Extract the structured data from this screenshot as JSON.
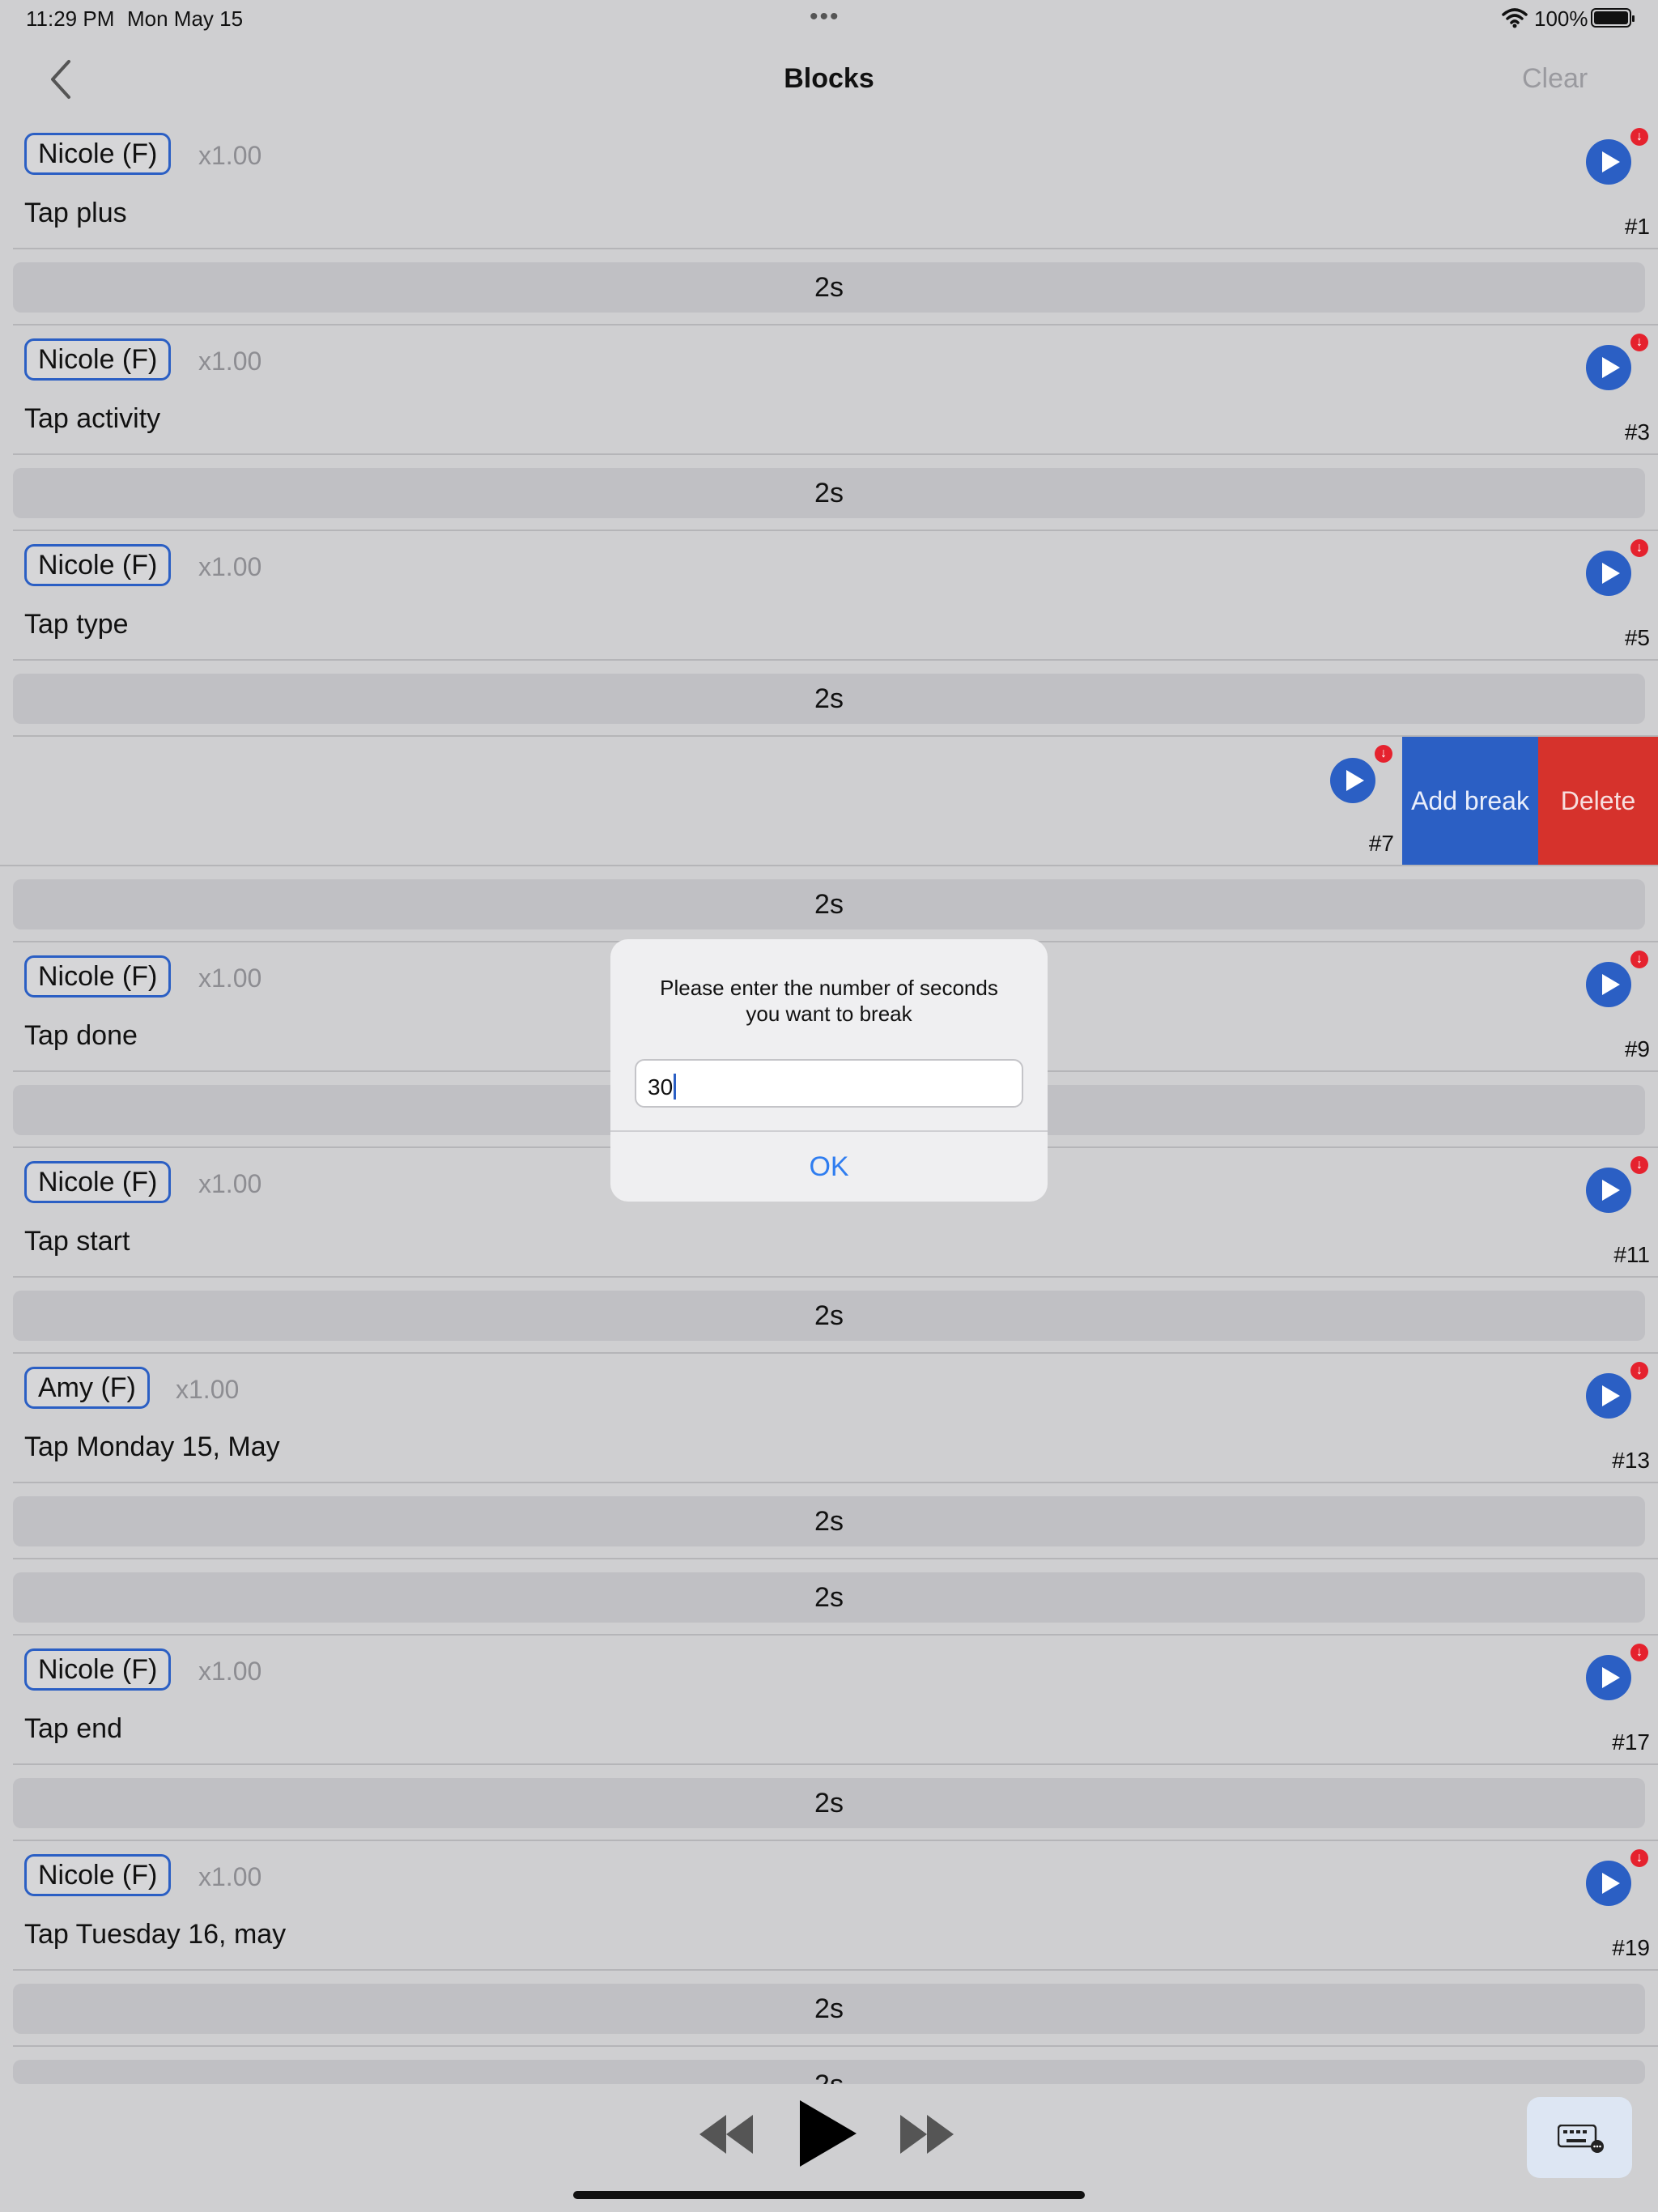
{
  "status": {
    "time": "11:29 PM",
    "date": "Mon May 15",
    "battery": "100%"
  },
  "nav": {
    "title": "Blocks",
    "clear": "Clear"
  },
  "rows": [
    {
      "voice": "Nicole (F)",
      "speed": "x1.00",
      "text": "Tap plus",
      "num": "#1"
    },
    {
      "voice": "Nicole (F)",
      "speed": "x1.00",
      "text": "Tap activity",
      "num": "#3"
    },
    {
      "voice": "Nicole (F)",
      "speed": "x1.00",
      "text": "Tap type",
      "num": "#5"
    },
    {
      "num": "#7"
    },
    {
      "voice": "Nicole (F)",
      "speed": "x1.00",
      "text": "Tap done",
      "num": "#9"
    },
    {
      "voice": "Nicole (F)",
      "speed": "x1.00",
      "text": "Tap start",
      "num": "#11"
    },
    {
      "voice": "Amy (F)",
      "speed": "x1.00",
      "text": "Tap Monday 15, May",
      "num": "#13"
    },
    {
      "voice": "Nicole (F)",
      "speed": "x1.00",
      "text": "Tap end",
      "num": "#17"
    },
    {
      "voice": "Nicole (F)",
      "speed": "x1.00",
      "text": "Tap Tuesday 16, may",
      "num": "#19"
    }
  ],
  "break_label": "2s",
  "swipe_actions": {
    "add_break": "Add break",
    "delete": "Delete"
  },
  "dialog": {
    "message_line1": "Please enter the number of seconds",
    "message_line2": "you want to break",
    "input_value": "30",
    "ok": "OK"
  },
  "badge_glyph": "↓",
  "colors": {
    "accent": "#2b5fc4",
    "delete": "#d6322c",
    "badge": "#e5222e",
    "link": "#2f7df0"
  }
}
